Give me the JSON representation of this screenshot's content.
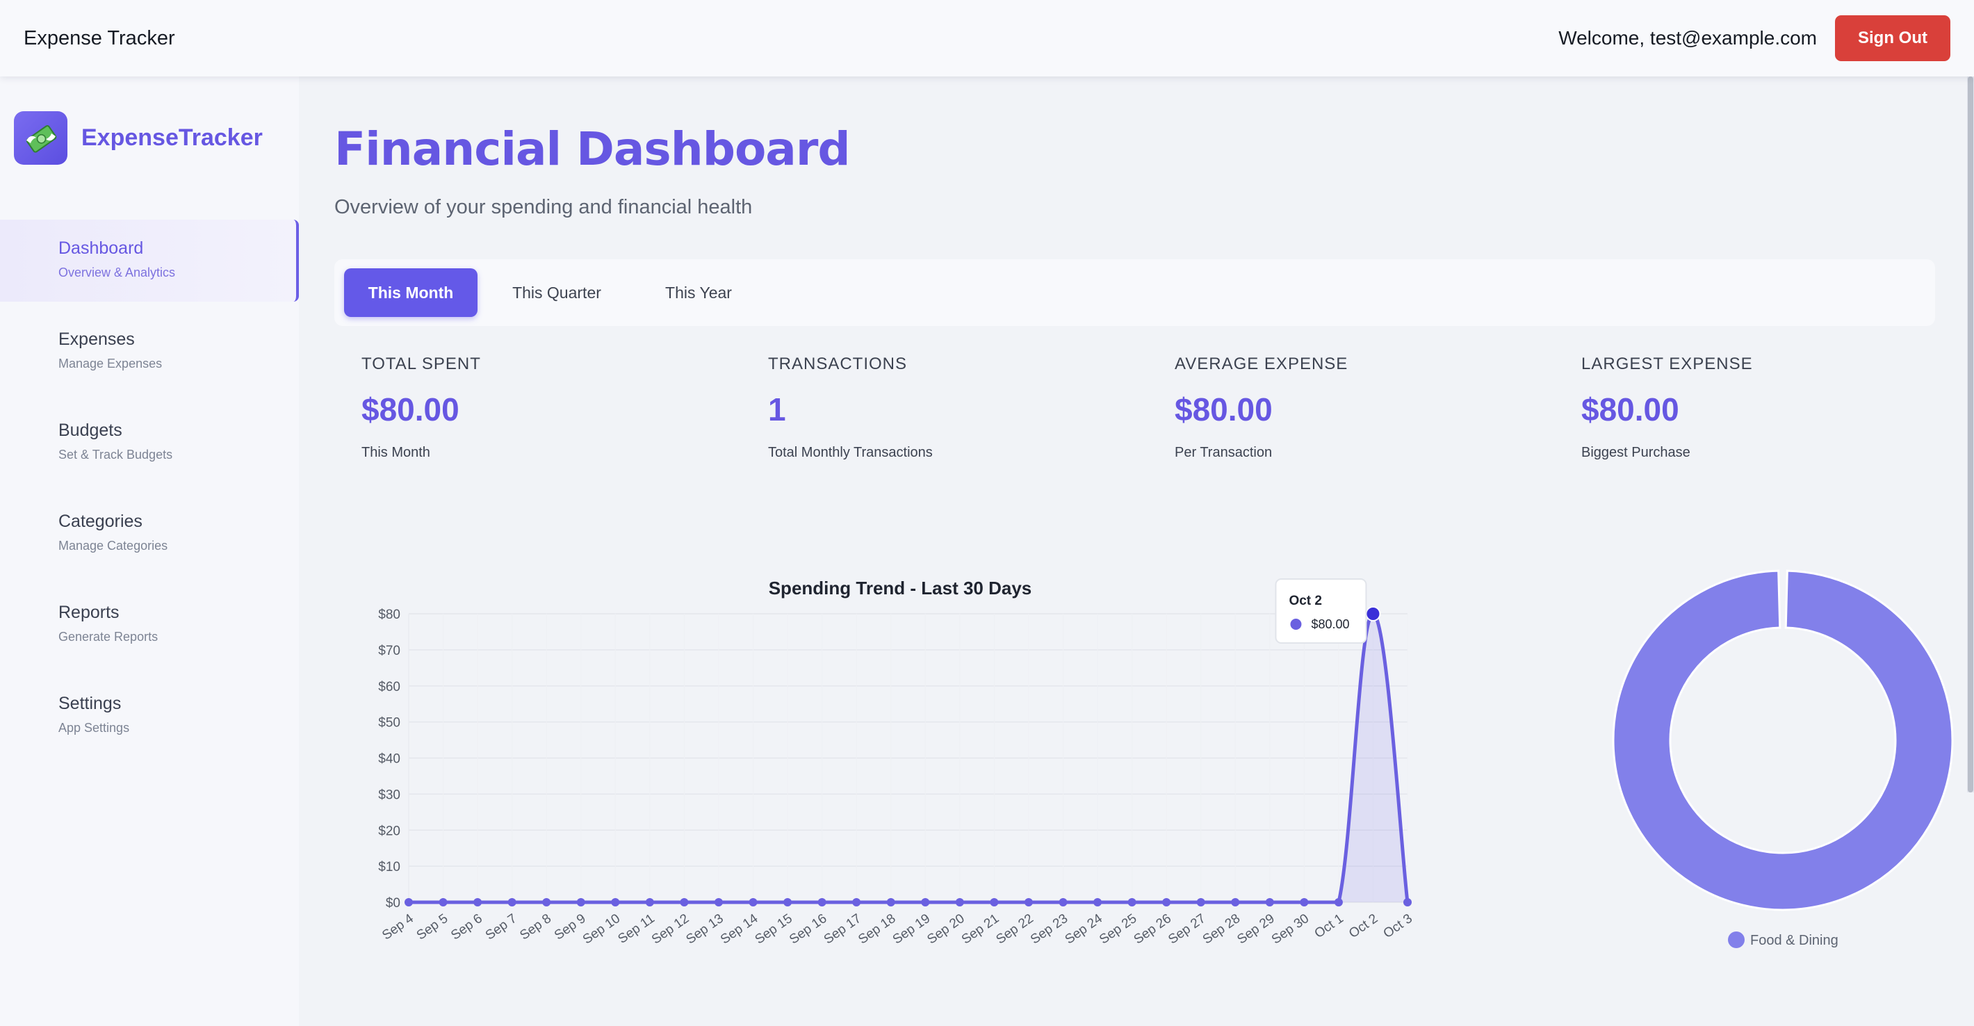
{
  "header": {
    "app_title": "Expense Tracker",
    "welcome_text": "Welcome, test@example.com",
    "signout_label": "Sign Out"
  },
  "sidebar": {
    "brand_name": "ExpenseTracker",
    "brand_icon": "money-wings-icon",
    "items": [
      {
        "label": "Dashboard",
        "sub": "Overview & Analytics",
        "active": true
      },
      {
        "label": "Expenses",
        "sub": "Manage Expenses",
        "active": false
      },
      {
        "label": "Budgets",
        "sub": "Set & Track Budgets",
        "active": false
      },
      {
        "label": "Categories",
        "sub": "Manage Categories",
        "active": false
      },
      {
        "label": "Reports",
        "sub": "Generate Reports",
        "active": false
      },
      {
        "label": "Settings",
        "sub": "App Settings",
        "active": false
      }
    ]
  },
  "main": {
    "title": "Financial Dashboard",
    "subtitle": "Overview of your spending and financial health",
    "period_tabs": [
      {
        "label": "This Month",
        "active": true
      },
      {
        "label": "This Quarter",
        "active": false
      },
      {
        "label": "This Year",
        "active": false
      }
    ],
    "stats": [
      {
        "label": "TOTAL SPENT",
        "value": "$80.00",
        "caption": "This Month"
      },
      {
        "label": "TRANSACTIONS",
        "value": "1",
        "caption": "Total Monthly Transactions"
      },
      {
        "label": "AVERAGE EXPENSE",
        "value": "$80.00",
        "caption": "Per Transaction"
      },
      {
        "label": "LARGEST EXPENSE",
        "value": "$80.00",
        "caption": "Biggest Purchase"
      }
    ]
  },
  "colors": {
    "accent": "#6657e2",
    "signout": "#d9403a",
    "line": "#6a60e0",
    "donut": "#8280ea"
  },
  "chart_data": [
    {
      "type": "line",
      "title": "Spending Trend - Last 30 Days",
      "x": [
        "Sep 4",
        "Sep 5",
        "Sep 6",
        "Sep 7",
        "Sep 8",
        "Sep 9",
        "Sep 10",
        "Sep 11",
        "Sep 12",
        "Sep 13",
        "Sep 14",
        "Sep 15",
        "Sep 16",
        "Sep 17",
        "Sep 18",
        "Sep 19",
        "Sep 20",
        "Sep 21",
        "Sep 22",
        "Sep 23",
        "Sep 24",
        "Sep 25",
        "Sep 26",
        "Sep 27",
        "Sep 28",
        "Sep 29",
        "Sep 30",
        "Oct 1",
        "Oct 2",
        "Oct 3"
      ],
      "values": [
        0,
        0,
        0,
        0,
        0,
        0,
        0,
        0,
        0,
        0,
        0,
        0,
        0,
        0,
        0,
        0,
        0,
        0,
        0,
        0,
        0,
        0,
        0,
        0,
        0,
        0,
        0,
        0,
        80,
        0
      ],
      "y_ticks": [
        "$0",
        "$10",
        "$20",
        "$30",
        "$40",
        "$50",
        "$60",
        "$70",
        "$80"
      ],
      "ylim": [
        0,
        80
      ],
      "grid": true,
      "fill": true,
      "tooltip": {
        "title": "Oct 2",
        "value": "$80.00",
        "index": 28
      }
    },
    {
      "type": "pie",
      "style": "donut",
      "labels": [
        "Food & Dining"
      ],
      "values": [
        80
      ],
      "legend": "bottom"
    }
  ]
}
